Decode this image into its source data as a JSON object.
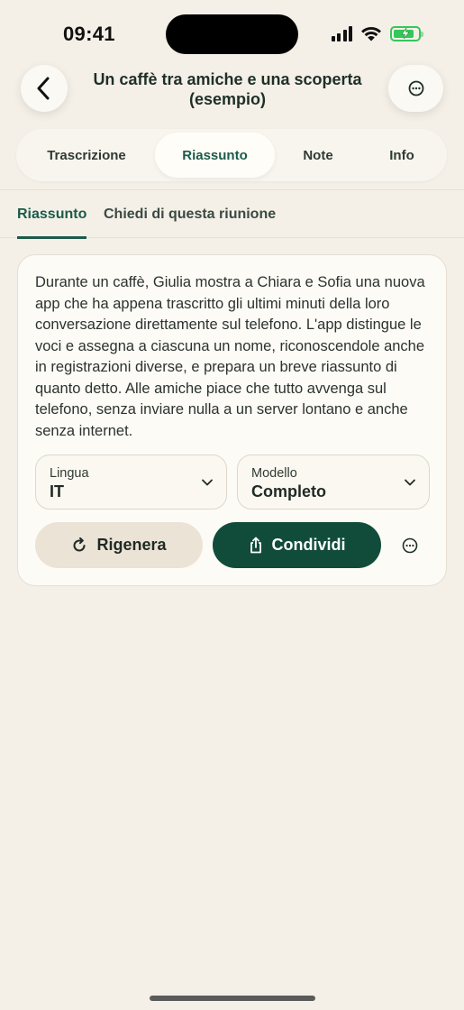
{
  "status_bar": {
    "time": "09:41"
  },
  "header": {
    "title": "Un caffè tra amiche e una scoperta (esempio)",
    "back_icon": "chevron-left-icon",
    "more_icon": "ellipsis-circle-icon"
  },
  "segments": [
    {
      "label": "Trascrizione",
      "active": false
    },
    {
      "label": "Riassunto",
      "active": true
    },
    {
      "label": "Note",
      "active": false
    },
    {
      "label": "Info",
      "active": false
    }
  ],
  "subtabs": [
    {
      "label": "Riassunto",
      "active": true
    },
    {
      "label": "Chiedi di questa riunione",
      "active": false
    }
  ],
  "summary": {
    "text": "Durante un caffè, Giulia mostra a Chiara e Sofia una nuova app che ha appena trascritto gli ultimi minuti della loro conversazione direttamente sul telefono. L'app distingue le voci e assegna a ciascuna un nome, riconoscendole anche in registrazioni diverse, e prepara un breve riassunto di quanto detto. Alle amiche piace che tutto avvenga sul telefono, senza inviare nulla a un server lontano e anche senza internet.",
    "language": {
      "label": "Lingua",
      "value": "IT"
    },
    "model": {
      "label": "Modello",
      "value": "Completo"
    },
    "regenerate_label": "Rigenera",
    "share_label": "Condividi"
  },
  "colors": {
    "background": "#f4f0e8",
    "accent": "#114c3b",
    "accent_text": "#1b5b49",
    "secondary_button": "#ebe3d6",
    "battery": "#34c759"
  }
}
